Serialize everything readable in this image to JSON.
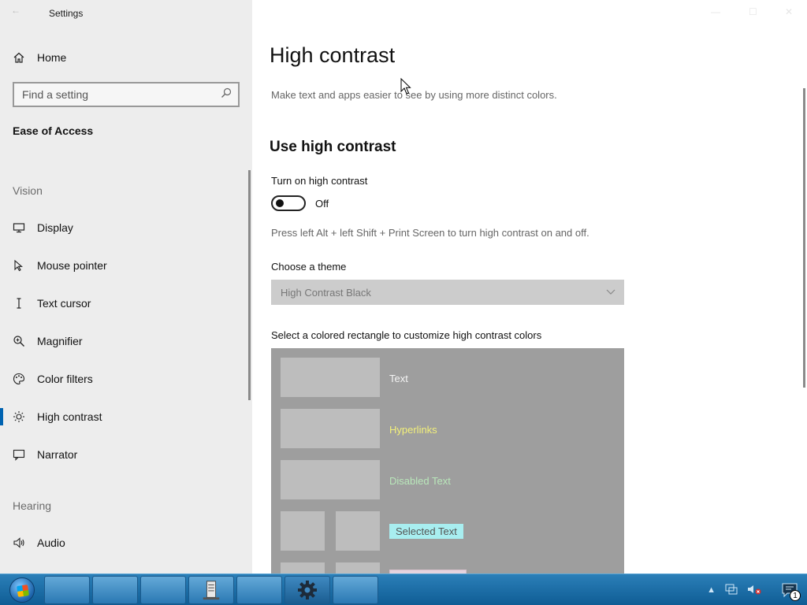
{
  "window": {
    "title": "Settings",
    "back_glyph": "←",
    "min_glyph": "—",
    "max_glyph": "☐",
    "close_glyph": "✕"
  },
  "sidebar": {
    "home_label": "Home",
    "search_placeholder": "Find a setting",
    "category": "Ease of Access",
    "sections": {
      "vision": "Vision",
      "hearing": "Hearing"
    },
    "vision_items": [
      {
        "label": "Display",
        "icon": "monitor-icon"
      },
      {
        "label": "Mouse pointer",
        "icon": "mouse-pointer-icon"
      },
      {
        "label": "Text cursor",
        "icon": "text-cursor-icon"
      },
      {
        "label": "Magnifier",
        "icon": "magnifier-icon"
      },
      {
        "label": "Color filters",
        "icon": "palette-icon"
      },
      {
        "label": "High contrast",
        "icon": "sun-icon",
        "active": true
      },
      {
        "label": "Narrator",
        "icon": "narrator-icon"
      }
    ],
    "hearing_items": [
      {
        "label": "Audio",
        "icon": "speaker-icon"
      }
    ]
  },
  "main": {
    "title": "High contrast",
    "description": "Make text and apps easier to see by using more distinct colors.",
    "use_heading": "Use high contrast",
    "toggle_label": "Turn on high contrast",
    "toggle_state": "Off",
    "toggle_on": false,
    "shortcut_hint": "Press left Alt + left Shift + Print Screen to turn high contrast on and off.",
    "theme_label": "Choose a theme",
    "theme_selected": "High Contrast Black",
    "colors_label": "Select a colored rectangle to customize high contrast colors",
    "color_items": {
      "text": "Text",
      "hyperlinks": "Hyperlinks",
      "disabled": "Disabled Text",
      "selected": "Selected Text"
    }
  },
  "taskbar": {
    "notification_count": "1",
    "colors": {
      "accent": "#0063b1",
      "taskbar": "#1a6aa6"
    }
  }
}
